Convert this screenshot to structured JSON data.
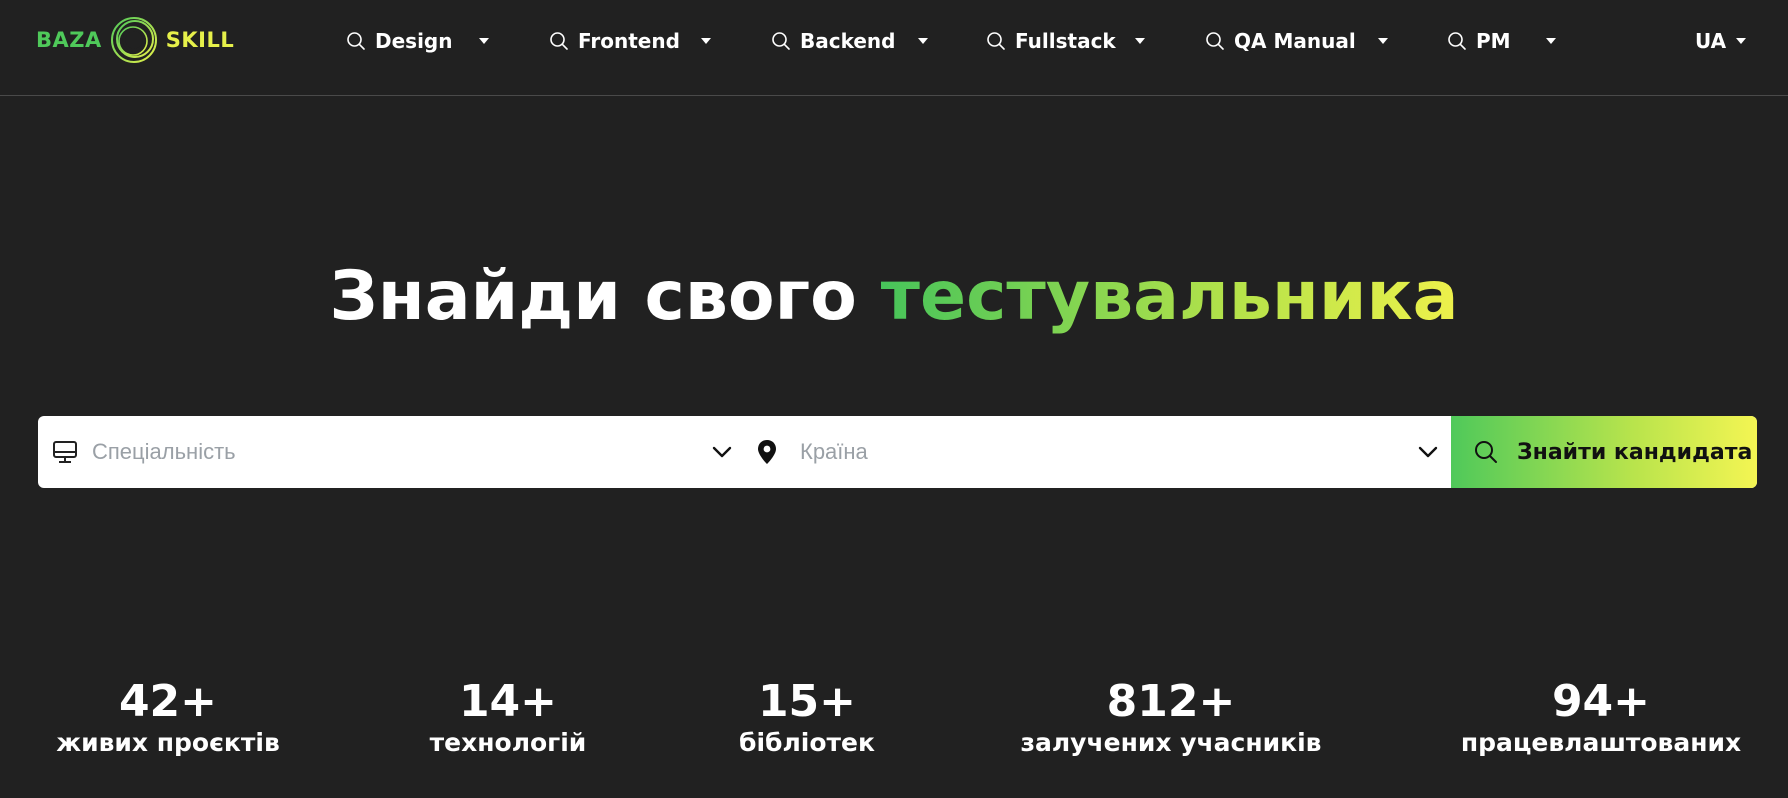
{
  "brand": {
    "left": "BAZA",
    "right": "SKILL",
    "colors": {
      "green": "#4fc95a",
      "yellow": "#e6f04a",
      "background": "#212121"
    }
  },
  "nav": {
    "items": [
      {
        "label": "Design",
        "icon": "search-icon"
      },
      {
        "label": "Frontend",
        "icon": "search-icon"
      },
      {
        "label": "Backend",
        "icon": "search-icon"
      },
      {
        "label": "Fullstack",
        "icon": "search-icon"
      },
      {
        "label": "QA Manual",
        "icon": "search-icon"
      },
      {
        "label": "PM",
        "icon": "search-icon"
      }
    ],
    "language": "UA"
  },
  "hero": {
    "title_plain": "Знайди свого",
    "title_accent": "тестувальника"
  },
  "search": {
    "specialty_placeholder": "Спеціальність",
    "country_placeholder": "Країна",
    "button_label": "Знайти кандидата"
  },
  "stats": [
    {
      "value": "42+",
      "caption": "живих проєктів"
    },
    {
      "value": "14+",
      "caption": "технологій"
    },
    {
      "value": "15+",
      "caption": "бібліотек"
    },
    {
      "value": "812+",
      "caption": "залучених учасників"
    },
    {
      "value": "94+",
      "caption": "працевлаштованих"
    }
  ]
}
